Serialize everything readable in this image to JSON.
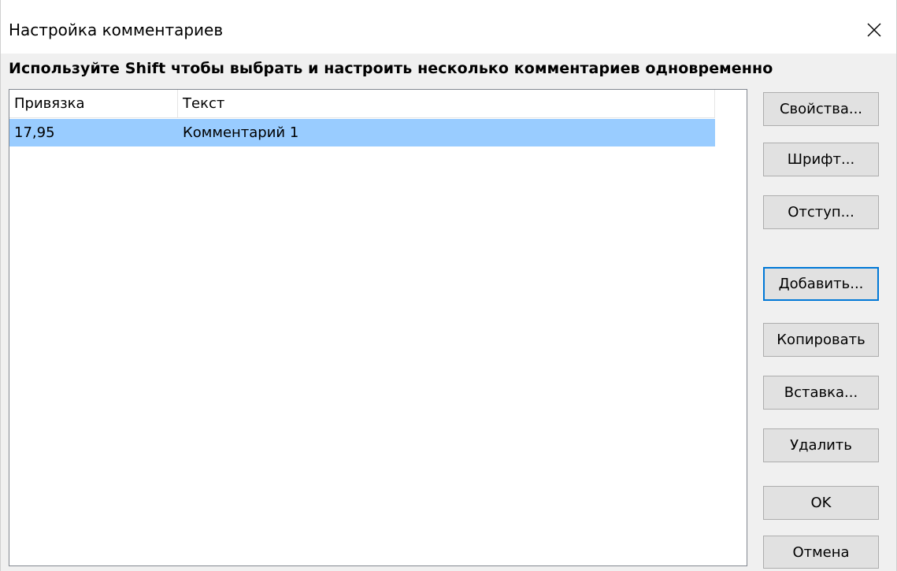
{
  "window": {
    "title": "Настройка комментариев",
    "close_icon": "close-icon"
  },
  "hint": "Используйте Shift чтобы выбрать и настроить несколько комментариев одновременно",
  "list": {
    "columns": [
      "Привязка",
      "Текст"
    ],
    "rows": [
      {
        "anchor": "17,95",
        "text": "Комментарий 1",
        "selected": true
      }
    ]
  },
  "buttons": {
    "properties": "Свойства...",
    "font": "Шрифт...",
    "indent": "Отступ...",
    "add": "Добавить...",
    "copy": "Копировать",
    "paste": "Вставка...",
    "delete": "Удалить",
    "ok": "OK",
    "cancel": "Отмена"
  },
  "colors": {
    "selection": "#99ccff",
    "focus_border": "#0078d7",
    "button_face": "#e1e1e1"
  }
}
